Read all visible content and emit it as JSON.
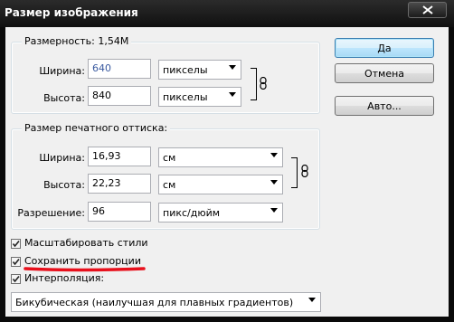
{
  "window": {
    "title": "Размер изображения"
  },
  "pixel_dimensions": {
    "legend": "Размерность:  1,54М",
    "width_label": "Ширина:",
    "width_value": "640",
    "width_unit": "пикселы",
    "height_label": "Высота:",
    "height_value": "840",
    "height_unit": "пикселы"
  },
  "document_size": {
    "legend": "Размер печатного оттиска:",
    "width_label": "Ширина:",
    "width_value": "16,93",
    "width_unit": "см",
    "height_label": "Высота:",
    "height_value": "22,23",
    "height_unit": "см",
    "resolution_label": "Разрешение:",
    "resolution_value": "96",
    "resolution_unit": "пикс/дюйм"
  },
  "buttons": {
    "ok": "Да",
    "cancel": "Отмена",
    "auto": "Авто..."
  },
  "options": {
    "scale_styles": {
      "label": "Масштабировать стили",
      "checked": true
    },
    "constrain_proportions": {
      "label": "Сохранить пропорции",
      "checked": true
    },
    "resample": {
      "label": "Интерполяция:",
      "checked": true
    }
  },
  "resample_method": "Бикубическая (наилучшая для плавных градиентов)",
  "colors": {
    "annotation_underline": "#e8101c",
    "default_button_border": "#3c7fb1"
  },
  "icons": [
    "close-icon",
    "chain-link-icon",
    "dropdown-arrow-icon",
    "checkmark-icon"
  ]
}
